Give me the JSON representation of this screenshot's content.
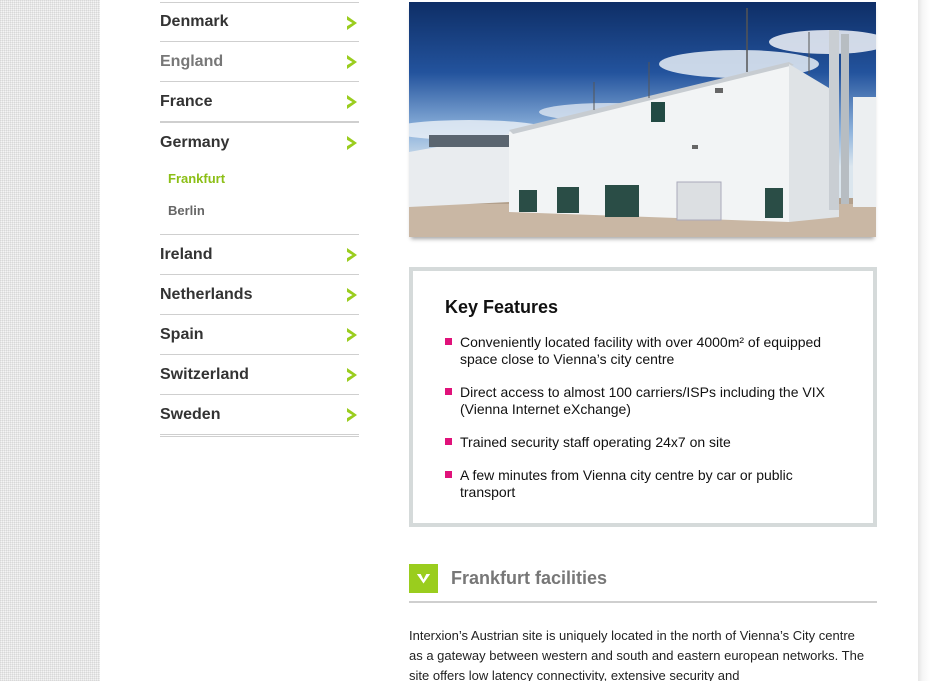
{
  "sidebar": {
    "countries_top": [
      {
        "label": "Denmark"
      },
      {
        "label": "England"
      },
      {
        "label": "France"
      }
    ],
    "germany": {
      "label": "Germany",
      "cities": [
        {
          "label": "Frankfurt",
          "active": true
        },
        {
          "label": "Berlin",
          "active": false
        }
      ]
    },
    "countries_bottom": [
      {
        "label": "Ireland"
      },
      {
        "label": "Netherlands"
      },
      {
        "label": "Spain"
      },
      {
        "label": "Switzerland"
      },
      {
        "label": "Sweden"
      }
    ]
  },
  "features": {
    "title": "Key Features",
    "items": [
      "Conveniently located facility with over 4000m² of equipped space close to Vienna’s city centre",
      "Direct access to almost 100 carriers/ISPs including the VIX (Vienna Internet eXchange)",
      "Trained security staff operating 24x7 on site",
      "A few minutes from Vienna city centre by car or public transport"
    ]
  },
  "section": {
    "title": "Frankfurt facilities"
  },
  "body": {
    "text": "Interxion’s Austrian site is uniquely located in the north of Vienna’s City centre as a gateway between western and south and eastern european networks. The site offers low latency connectivity, extensive security and"
  },
  "colors": {
    "accent_green": "#9acd1e",
    "active_link": "#8cbf16",
    "bullet_magenta": "#e0127a",
    "border_grey": "#d5dada"
  },
  "icons": {
    "arrow": "arrow-right-icon",
    "toggle": "chevron-down-icon",
    "bullet": "square-bullet-icon"
  }
}
